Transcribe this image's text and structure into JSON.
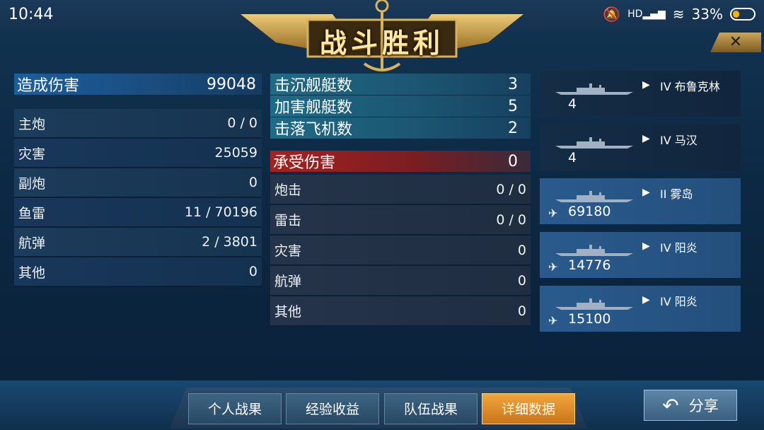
{
  "status_bar": {
    "time": "10:44",
    "hd_label": "HD",
    "battery_text": "33%",
    "battery_level": 0.33
  },
  "header": {
    "title": "战斗胜利",
    "close_glyph": "✕"
  },
  "damage_dealt": {
    "label": "造成伤害",
    "total": "99048",
    "rows": [
      {
        "label": "主炮",
        "value": "0 / 0"
      },
      {
        "label": "灾害",
        "value": "25059"
      },
      {
        "label": "副炮",
        "value": "0"
      },
      {
        "label": "鱼雷",
        "value": "11 / 70196"
      },
      {
        "label": "航弹",
        "value": "2 / 3801"
      },
      {
        "label": "其他",
        "value": "0"
      }
    ]
  },
  "kills": [
    {
      "label": "击沉舰艇数",
      "value": "3"
    },
    {
      "label": "加害舰艇数",
      "value": "5"
    },
    {
      "label": "击落飞机数",
      "value": "2"
    }
  ],
  "damage_received": {
    "label": "承受伤害",
    "total": "0",
    "rows": [
      {
        "label": "炮击",
        "value": "0 / 0"
      },
      {
        "label": "雷击",
        "value": "0 / 0"
      },
      {
        "label": "灾害",
        "value": "0"
      },
      {
        "label": "航弹",
        "value": "0"
      },
      {
        "label": "其他",
        "value": "0"
      }
    ]
  },
  "ships": [
    {
      "tier": "IV",
      "name": "布鲁克林",
      "value": "4",
      "highlight": false,
      "icon": "battleship-icon"
    },
    {
      "tier": "IV",
      "name": "马汉",
      "value": "4",
      "highlight": false,
      "icon": "destroyer-icon"
    },
    {
      "tier": "II",
      "name": "雾岛",
      "value": "69180",
      "highlight": true,
      "icon": "battleship-icon"
    },
    {
      "tier": "IV",
      "name": "阳炎",
      "value": "14776",
      "highlight": true,
      "icon": "destroyer-icon"
    },
    {
      "tier": "IV",
      "name": "阳炎",
      "value": "15100",
      "highlight": true,
      "icon": "destroyer-icon"
    }
  ],
  "tabs": [
    {
      "label": "个人战果",
      "active": false
    },
    {
      "label": "经验收益",
      "active": false
    },
    {
      "label": "队伍战果",
      "active": false
    },
    {
      "label": "详细数据",
      "active": true
    }
  ],
  "share": {
    "label": "分享",
    "icon": "back-arrow-icon"
  },
  "colors": {
    "accent_orange": "#f2a63b",
    "header_blue": "#1b5e9e",
    "header_red": "#a5221f"
  }
}
